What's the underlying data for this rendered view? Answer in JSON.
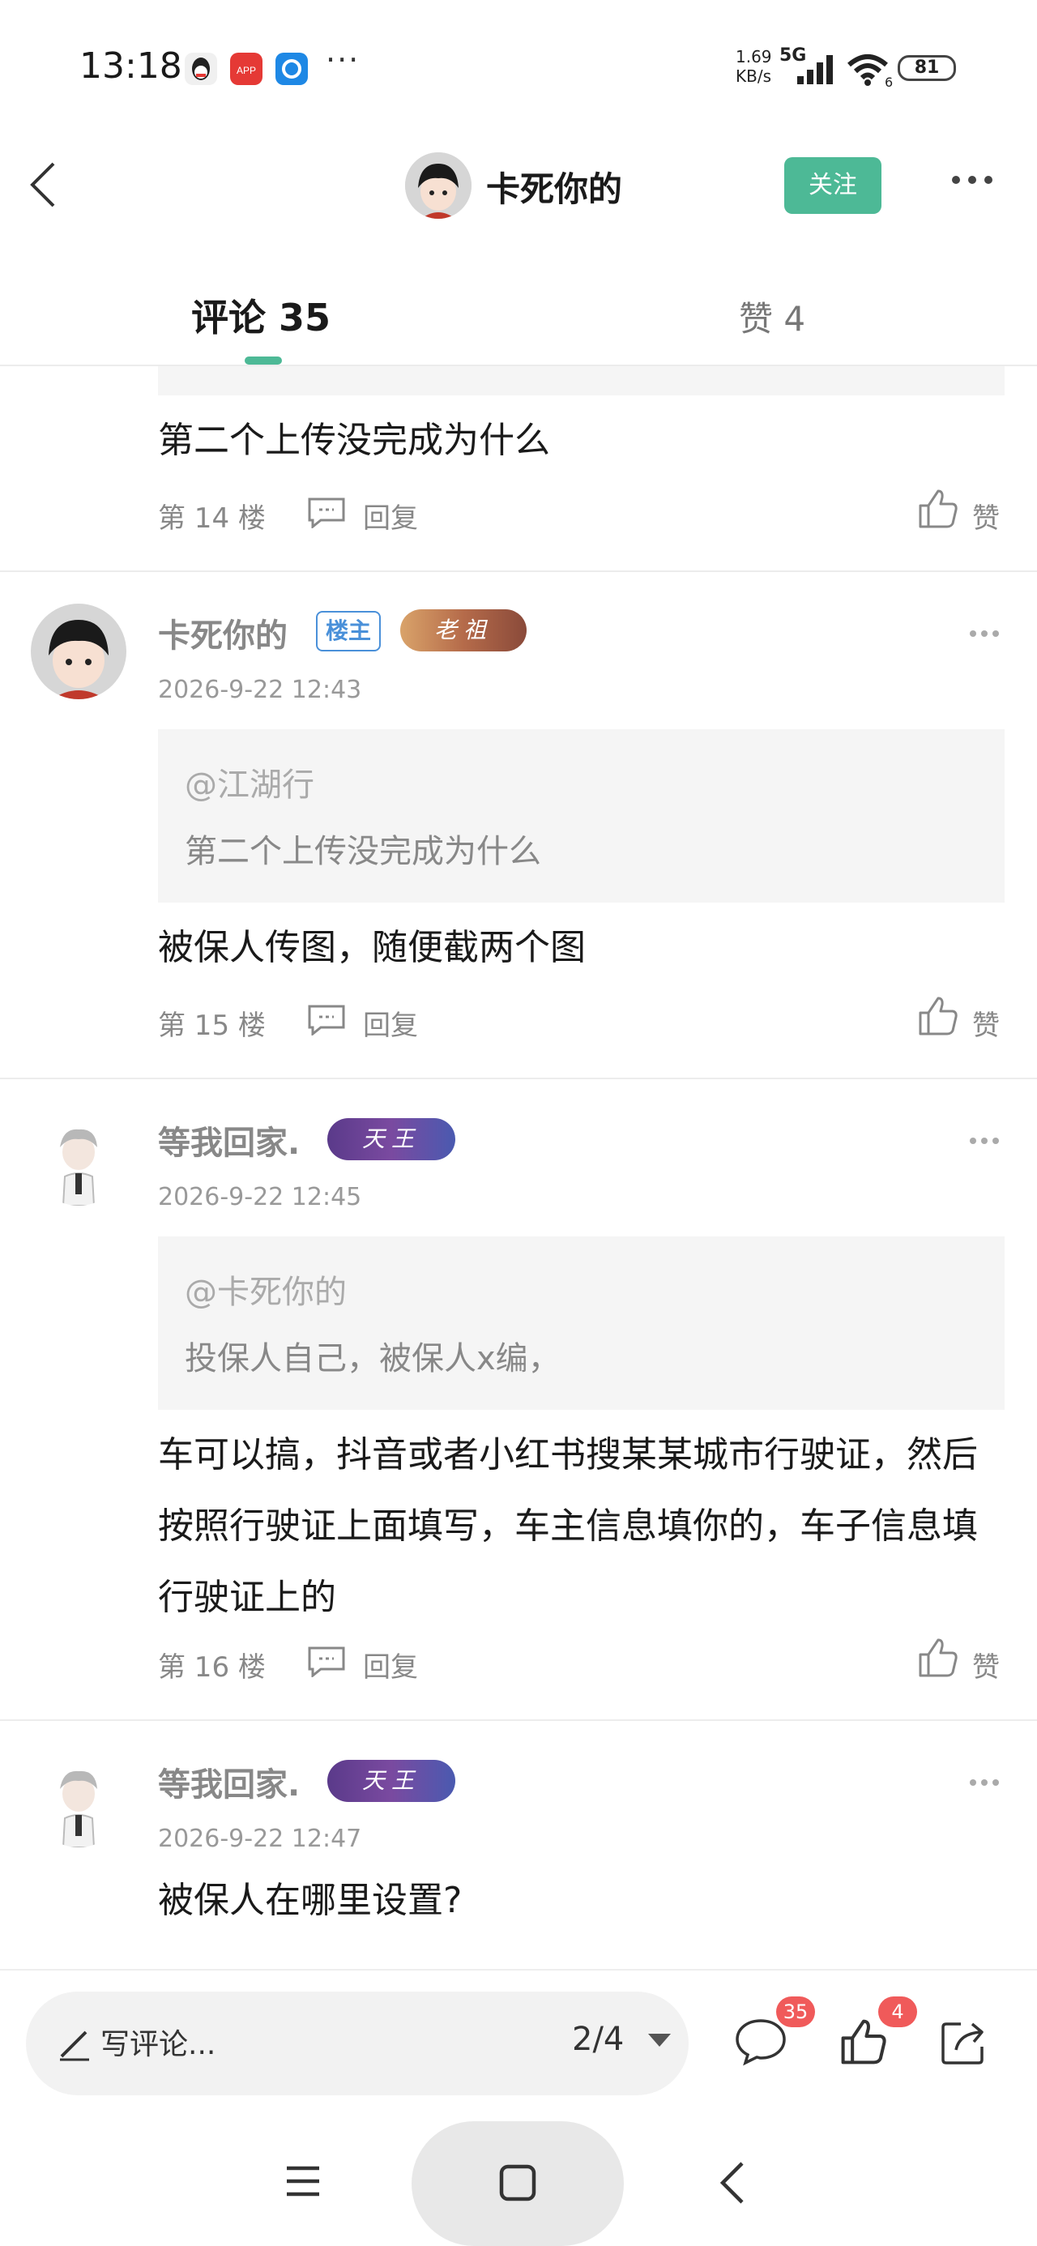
{
  "status_bar": {
    "time": "13:18",
    "speed_value": "1.69",
    "speed_unit": "KB/s",
    "network": "5G",
    "battery": "81",
    "overflow": "···",
    "wifi_level": "6"
  },
  "header": {
    "title": "卡死你的",
    "follow_label": "关注"
  },
  "tabs": {
    "comments_label": "评论 35",
    "likes_label": "赞 4"
  },
  "comments": [
    {
      "text": "第二个上传没完成为什么",
      "floor": "第 14 楼",
      "reply_label": "回复",
      "like_label": "赞"
    },
    {
      "username": "卡死你的",
      "owner_badge": "楼主",
      "rank_badge": "老祖",
      "date": "2026-9-22 12:43",
      "quote_at": "@江湖行",
      "quote_text": "第二个上传没完成为什么",
      "text": "被保人传图，随便截两个图",
      "floor": "第 15 楼",
      "reply_label": "回复",
      "like_label": "赞"
    },
    {
      "username": "等我回家.",
      "rank_badge": "天王",
      "date": "2026-9-22 12:45",
      "quote_at": "@卡死你的",
      "quote_text": "投保人自己，被保人x编，",
      "text": "车可以搞，抖音或者小红书搜某某城市行驶证，然后按照行驶证上面填写，车主信息填你的，车子信息填行驶证上的",
      "floor": "第 16 楼",
      "reply_label": "回复",
      "like_label": "赞"
    },
    {
      "username": "等我回家.",
      "rank_badge": "天王",
      "date": "2026-9-22 12:47",
      "text": "被保人在哪里设置?"
    }
  ],
  "bottom_bar": {
    "write_placeholder": "写评论...",
    "page_indicator": "2/4",
    "comment_count": "35",
    "like_count": "4"
  },
  "colors": {
    "accent": "#4db996",
    "badge_red": "#f05a5a",
    "owner_blue": "#4a90d9"
  }
}
